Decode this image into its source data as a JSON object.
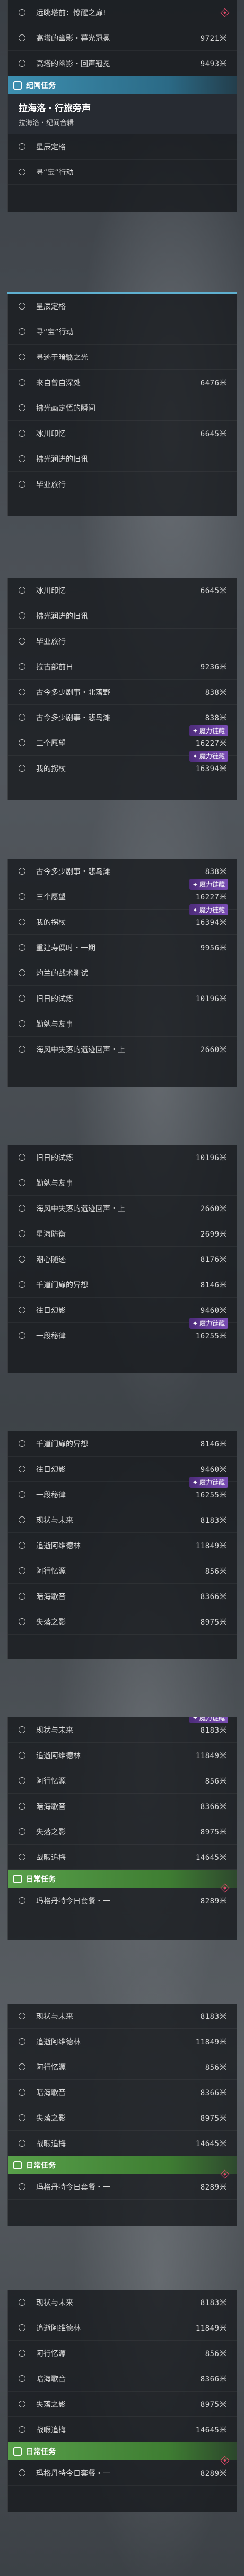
{
  "p1": {
    "rows": [
      {
        "title": "远眺塔前：惊醒之扉!",
        "dist": ""
      },
      {
        "title": "高塔的幽影・暮光冠冕",
        "dist": "9721米"
      },
      {
        "title": "高塔的幽影・回声冠冕",
        "dist": "9493米"
      }
    ],
    "section_label": "纪闻任务",
    "highlight_title": "拉海洛・行旅旁声",
    "highlight_sub": "拉海洛・纪闻合辑",
    "rows2": [
      {
        "title": "星辰定格",
        "dist": ""
      },
      {
        "title": "寻“宝”行动",
        "dist": ""
      }
    ]
  },
  "p2": {
    "rows": [
      {
        "title": "星辰定格",
        "dist": ""
      },
      {
        "title": "寻“宝”行动",
        "dist": ""
      },
      {
        "title": "寻迹于暗翳之光",
        "dist": ""
      },
      {
        "title": "来自曾自深处",
        "dist": "6476米"
      },
      {
        "title": "拂光画定悟的瞬间",
        "dist": ""
      },
      {
        "title": "冰川印忆",
        "dist": "6645米"
      },
      {
        "title": "拂光润进的旧讯",
        "dist": ""
      },
      {
        "title": "毕业旅行",
        "dist": ""
      }
    ]
  },
  "p3": {
    "rows": [
      {
        "title": "冰川印忆",
        "dist": "6645米"
      },
      {
        "title": "拂光润进的旧讯",
        "dist": ""
      },
      {
        "title": "毕业旅行",
        "dist": ""
      },
      {
        "title": "拉古部前日",
        "dist": "9236米"
      },
      {
        "title": "古今多少剧事・北落野",
        "dist": "838米"
      },
      {
        "title": "古今多少剧事・悲鸟滩",
        "dist": "838米"
      },
      {
        "title": "三个愿望",
        "dist": "16227米"
      },
      {
        "title": "我的拐杖",
        "dist": "16394米"
      }
    ],
    "tag": "魔力链藏"
  },
  "p4": {
    "rows": [
      {
        "title": "古今多少剧事・悲鸟滩",
        "dist": "838米"
      },
      {
        "title": "三个愿望",
        "dist": "16227米"
      },
      {
        "title": "我的拐杖",
        "dist": "16394米"
      },
      {
        "title": "重建寿偶时・一期",
        "dist": "9956米"
      },
      {
        "title": "灼兰的战术测试",
        "dist": ""
      },
      {
        "title": "旧日的试炼",
        "dist": "10196米"
      },
      {
        "title": "勤勉与友事",
        "dist": ""
      },
      {
        "title": "海风中失落的遗迹回声・上",
        "dist": "2660米"
      }
    ],
    "tag": "魔力链藏"
  },
  "p5": {
    "rows": [
      {
        "title": "旧日的试炼",
        "dist": "10196米"
      },
      {
        "title": "勤勉与友事",
        "dist": ""
      },
      {
        "title": "海风中失落的遗迹回声・上",
        "dist": "2660米"
      },
      {
        "title": "星海防衡",
        "dist": "2699米"
      },
      {
        "title": "潮心随迹",
        "dist": "8176米"
      },
      {
        "title": "千道门扉的异想",
        "dist": "8146米"
      },
      {
        "title": "往日幻影",
        "dist": "9460米"
      },
      {
        "title": "一段秘律",
        "dist": "16255米"
      }
    ],
    "tag": "魔力链藏"
  },
  "p6": {
    "rows": [
      {
        "title": "千道门扉的异想",
        "dist": "8146米"
      },
      {
        "title": "往日幻影",
        "dist": "9460米"
      },
      {
        "title": "一段秘律",
        "dist": "16255米"
      },
      {
        "title": "现状与未来",
        "dist": "8183米"
      },
      {
        "title": "追逝阿维德林",
        "dist": "11849米"
      },
      {
        "title": "阿行忆源",
        "dist": "856米"
      },
      {
        "title": "暗海歌音",
        "dist": "8366米"
      },
      {
        "title": "失落之影",
        "dist": "8975米"
      }
    ],
    "tag": "魔力链藏"
  },
  "p7": {
    "rows": [
      {
        "title": "现状与未来",
        "dist": "8183米"
      },
      {
        "title": "追逝阿维德林",
        "dist": "11849米"
      },
      {
        "title": "阿行忆源",
        "dist": "856米"
      },
      {
        "title": "暗海歌音",
        "dist": "8366米"
      },
      {
        "title": "失落之影",
        "dist": "8975米"
      },
      {
        "title": "战暇追梅",
        "dist": "14645米"
      }
    ],
    "tag": "魔力链藏",
    "section_label": "日常任务",
    "daily": {
      "title": "玛格丹特今日套餐・一",
      "dist": "8289米"
    }
  },
  "p8": {
    "rows": [
      {
        "title": "现状与未来",
        "dist": "8183米"
      },
      {
        "title": "追逝阿维德林",
        "dist": "11849米"
      },
      {
        "title": "阿行忆源",
        "dist": "856米"
      },
      {
        "title": "暗海歌音",
        "dist": "8366米"
      },
      {
        "title": "失落之影",
        "dist": "8975米"
      },
      {
        "title": "战暇追梅",
        "dist": "14645米"
      }
    ],
    "section_label": "日常任务",
    "daily": {
      "title": "玛格丹特今日套餐・一",
      "dist": "8289米"
    }
  },
  "p9": {
    "rows": [
      {
        "title": "现状与未来",
        "dist": "8183米"
      },
      {
        "title": "追逝阿维德林",
        "dist": "11849米"
      },
      {
        "title": "阿行忆源",
        "dist": "856米"
      },
      {
        "title": "暗海歌音",
        "dist": "8366米"
      },
      {
        "title": "失落之影",
        "dist": "8975米"
      },
      {
        "title": "战暇追梅",
        "dist": "14645米"
      }
    ],
    "section_label": "日常任务",
    "daily": {
      "title": "玛格丹特今日套餐・一",
      "dist": "8289米"
    }
  },
  "colors": {
    "section_blue": "#3d8fb0",
    "section_green": "#58a04a",
    "tag_purple": "#7a4db5",
    "alert_red": "#e04a6a"
  }
}
